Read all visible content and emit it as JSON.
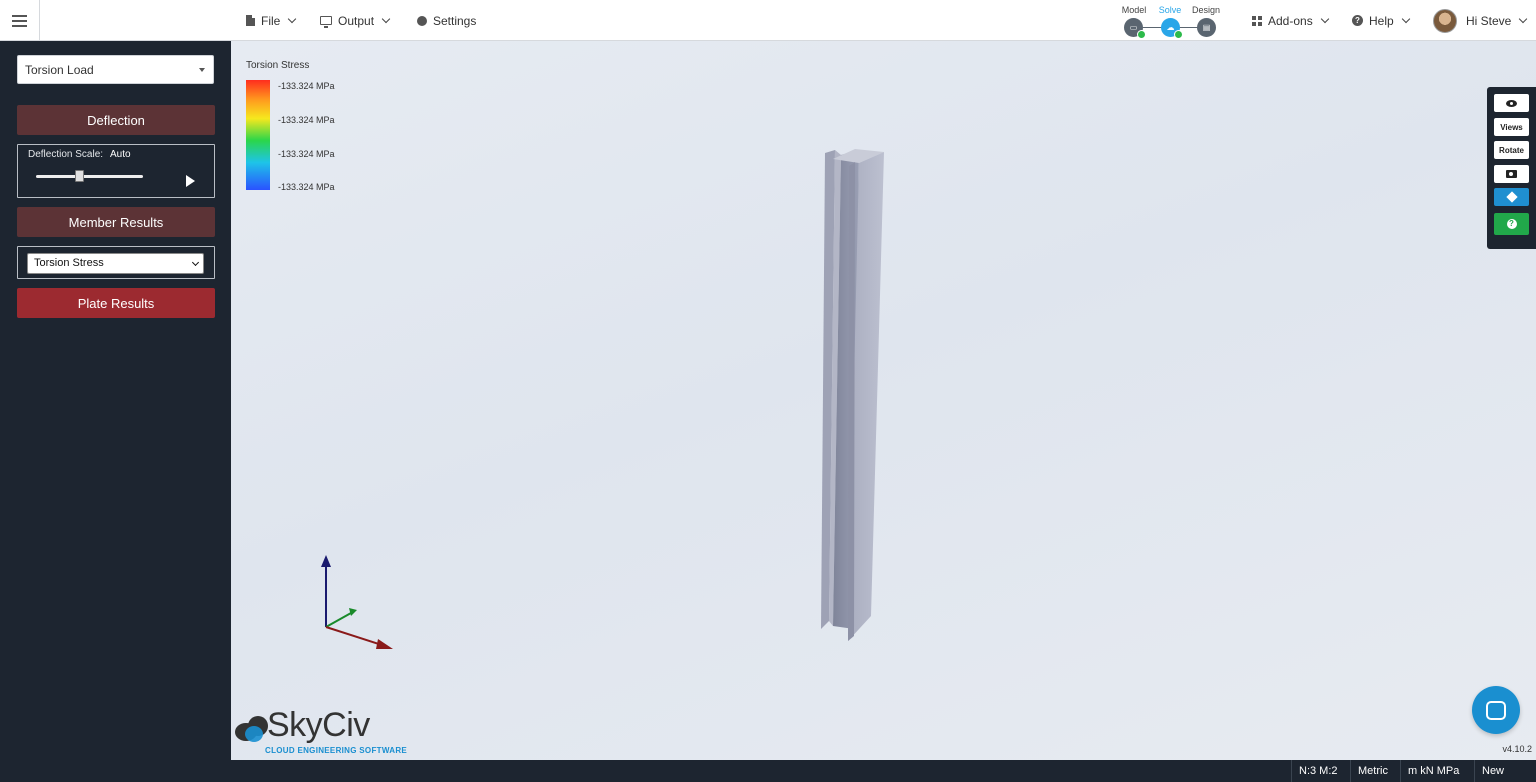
{
  "header": {
    "file_label": "File",
    "output_label": "Output",
    "settings_label": "Settings",
    "addons_label": "Add-ons",
    "help_label": "Help",
    "greeting": "Hi Steve",
    "steps": [
      {
        "label": "Model",
        "done": true
      },
      {
        "label": "Solve",
        "done": true,
        "active": true
      },
      {
        "label": "Design",
        "done": false
      }
    ]
  },
  "sidebar": {
    "load_case": "Torsion Load",
    "deflection_label": "Deflection",
    "deflection_scale_label": "Deflection Scale:",
    "deflection_scale_value": "Auto",
    "member_results_label": "Member Results",
    "result_type": "Torsion Stress",
    "plate_results_label": "Plate Results"
  },
  "legend": {
    "title": "Torsion Stress",
    "ticks": [
      "-133.324 MPa",
      "-133.324 MPa",
      "-133.324 MPa",
      "-133.324 MPa"
    ]
  },
  "toolbox": {
    "views_label": "Views",
    "rotate_label": "Rotate"
  },
  "branding": {
    "logo_text": "SkyCiv",
    "logo_tagline": "CLOUD ENGINEERING SOFTWARE",
    "version": "v4.10.2"
  },
  "statusbar": {
    "counts": "N:3  M:2",
    "units_system": "Metric",
    "units": "m  kN  MPa",
    "file_name": "New File*"
  },
  "colors": {
    "sidebar_bg": "#1d2530",
    "button_dark": "#5c3336",
    "button_red": "#9c2a30",
    "accent_blue": "#1a8fd0",
    "accent_green": "#21a84a"
  }
}
